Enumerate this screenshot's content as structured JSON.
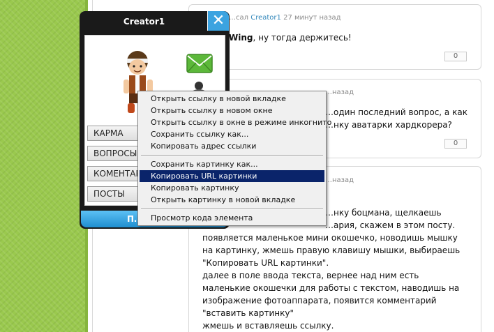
{
  "colors": {
    "green_strip": "#9ac94e",
    "popup_blue": "#3ba3e0",
    "menu_highlight": "#0a246a",
    "author_link": "#3388bb"
  },
  "comments": [
    {
      "meta_prefix": "…сал",
      "author": "Creator1",
      "time": "27 минут назад",
      "text_bold": "Wing",
      "text_rest": ", ну тогда держитесь!",
      "votes": "0"
    },
    {
      "meta_prefix": "…назад",
      "lines": [
        "…один последний вопрос, а как",
        "…нку аватарки хардкорера?"
      ],
      "votes": "0"
    },
    {
      "meta_prefix": "…назад",
      "lines": [
        "…нку боцмана, щелкаешь",
        "…ария, скажем в этом посту.",
        "появляется маленькое мини окошечко, новодишь мышку",
        "на картинку, жмешь правую клавишу мышки, выбираешь",
        "\"Копировать URL картинки\".",
        "далее в поле ввода текста, вернее над ним есть",
        "маленькие окошечки для работы с текстом, наводишь на",
        "изображение фотоаппарата, появится комментарий",
        "\"вставить картинку\"",
        "жмешь и вставляешь ссылку."
      ]
    }
  ],
  "popup": {
    "title": "Creator1",
    "close_glyph": "✕",
    "buttons": [
      "КАРМА",
      "ВОПРОСЫ",
      "КОМЕНТАРИИ",
      "ПОСТЫ"
    ],
    "bottom_label": "П…",
    "avatar_icon": "avatar-icon",
    "mail_icon": "mail-envelope-icon",
    "person_icon": "person-icon"
  },
  "context_menu": {
    "group1": [
      "Открыть ссылку в новой вкладке",
      "Открыть ссылку в новом окне",
      "Открыть ссылку в окне в режиме инкогнито",
      "Сохранить ссылку как...",
      "Копировать адрес ссылки"
    ],
    "group2": [
      "Сохранить картинку как...",
      "Копировать URL картинки",
      "Копировать картинку",
      "Открыть картинку в новой вкладке"
    ],
    "group3": [
      "Просмотр кода элемента"
    ],
    "selected": "Копировать URL картинки"
  }
}
